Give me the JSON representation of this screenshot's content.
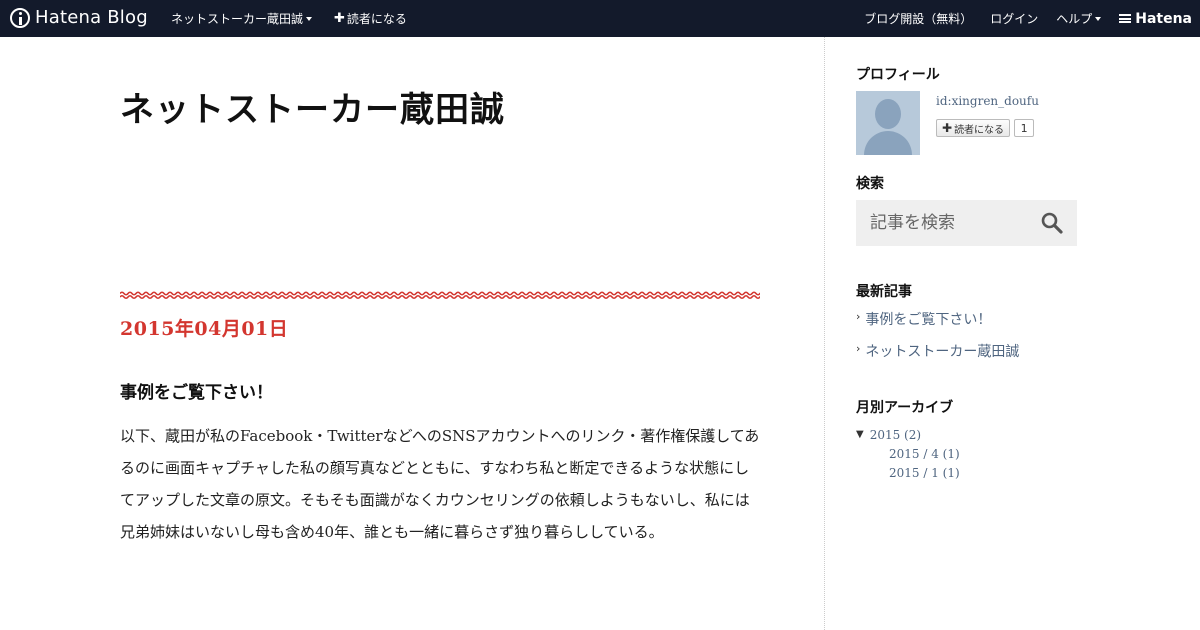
{
  "global_header": {
    "logo_text": "Hatena Blog",
    "blog_menu": "ネットストーカー蔵田誠",
    "subscribe": "読者になる",
    "open_blog": "ブログ開設（無料）",
    "login": "ログイン",
    "help": "ヘルプ",
    "brand": "Hatena"
  },
  "blog": {
    "title": "ネットストーカー蔵田誠"
  },
  "entry": {
    "date": "2015年04月01日",
    "title": "事例をご覧下さい！",
    "body": "以下、蔵田が私のFacebook・TwitterなどへのSNSアカウントへのリンク・著作権保護してあるのに画面キャプチャした私の顔写真などとともに、すなわち私と断定できるような状態にしてアップした文章の原文。そもそも面識がなくカウンセリングの依頼しようもないし、私には兄弟姉妹はいないし母も含め40年、誰とも一緒に暮らさず独り暮らししている。"
  },
  "sidebar": {
    "profile": {
      "title": "プロフィール",
      "id": "id:xingren_doufu",
      "subscribe_label": "読者になる",
      "subscriber_count": "1"
    },
    "search": {
      "title": "検索",
      "placeholder": "記事を検索"
    },
    "recent": {
      "title": "最新記事",
      "items": [
        "事例をご覧下さい！",
        "ネットストーカー蔵田誠"
      ]
    },
    "archive": {
      "title": "月別アーカイブ",
      "year": "2015 (2)",
      "months": [
        "2015 / 4 (1)",
        "2015 / 1 (1)"
      ]
    }
  },
  "colors": {
    "header_bg": "#131a2b",
    "accent_red": "#d3362f",
    "link": "#4f6580"
  }
}
